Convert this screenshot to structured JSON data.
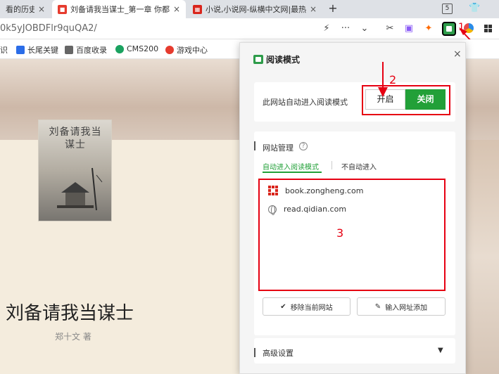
{
  "tabs": [
    {
      "title": "看的历史",
      "favicon_color": "#2b6de8"
    },
    {
      "title": "刘备请我当谋士_第一章 你都二",
      "favicon_color": "#e63b2e"
    },
    {
      "title": "小说,小说网-纵横中文网|最热",
      "favicon_color": "#d9251c"
    }
  ],
  "new_tab": "+",
  "tab_count": "5",
  "address": {
    "url": "0k5yJOBDFlr9quQA2/"
  },
  "toolbar": {
    "lightning": "⚡",
    "more": "···",
    "down": "⌄",
    "cut": "✂",
    "number_1": "1"
  },
  "bookmarks": [
    {
      "label": "识",
      "color": "#999999"
    },
    {
      "label": "长尾关键",
      "color": "#2b6de8"
    },
    {
      "label": "百度收录",
      "color": "#666666"
    },
    {
      "label": "CMS200",
      "color": "#1aa260"
    },
    {
      "label": "游戏中心",
      "color": "#e63b2e"
    }
  ],
  "book": {
    "cover_title": "刘备请我当谋士",
    "title": "刘备请我当谋士",
    "author": "郑十文 著"
  },
  "panel": {
    "title": "阅读模式",
    "close": "×",
    "auto_enter_label": "此网站自动进入阅读模式",
    "on_label": "开启",
    "off_label": "关闭",
    "number_2": "2",
    "site_mgmt_label": "网站管理",
    "help": "?",
    "subtab_auto": "自动进入阅读模式",
    "subtab_manual": "不自动进入",
    "sites": [
      "book.zongheng.com",
      "read.qidian.com"
    ],
    "number_3": "3",
    "remove_btn": "移除当前网站",
    "remove_icon": "✔",
    "add_btn": "输入网址添加",
    "add_icon": "✎",
    "advanced_label": "高级设置",
    "advanced_caret": "▼"
  },
  "colors": {
    "accent_green": "#22a038",
    "annotation_red": "#e60012"
  }
}
